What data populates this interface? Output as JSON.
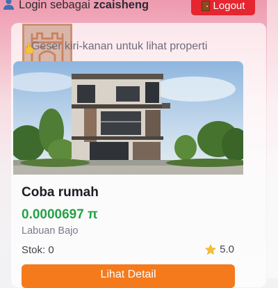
{
  "header": {
    "login_prefix": "Login sebagai",
    "username": "zcaisheng",
    "logout_label": "Logout",
    "user_icon": "user-icon",
    "logout_icon": "door-icon"
  },
  "hint": {
    "text": "Geser kiri-kanan untuk lihat properti",
    "icon": "pointing-hand-icon"
  },
  "property": {
    "title": "Coba rumah",
    "price": "0.0000697 π",
    "location": "Labuan Bajo",
    "stock": "Stok: 0",
    "rating": "5.0",
    "rating_icon": "star-icon",
    "detail_button": "Lihat Detail"
  },
  "colors": {
    "logout_bg": "#e5252f",
    "price_green": "#26a147",
    "detail_orange": "#f47a1c",
    "header_gradient_top": "#ee9aaf"
  }
}
